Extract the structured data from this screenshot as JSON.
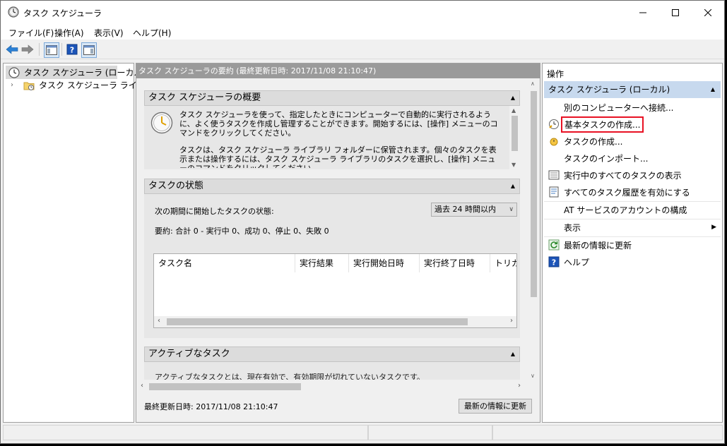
{
  "window": {
    "title": "タスク スケジューラ"
  },
  "menu": [
    "ファイル(F)",
    "操作(A)",
    "表示(V)",
    "ヘルプ(H)"
  ],
  "tree": {
    "root": "タスク スケジューラ (ローカル)",
    "child": "タスク スケジューラ ライブラリ"
  },
  "center": {
    "header": "タスク スケジューラの要約 (最終更新日時: 2017/11/08 21:10:47)",
    "overview": {
      "title": "タスク スケジューラの概要",
      "para1": "タスク スケジューラを使って、指定したときにコンピューターで自動的に実行されるように、よく使うタスクを作成し管理することができます。開始するには、[操作] メニューのコマンドをクリックしてください。",
      "para2": "タスクは、タスク スケジューラ ライブラリ フォルダーに保管されます。個々のタスクを表示または操作するには、タスク スケジューラ ライブラリのタスクを選択し、[操作] メニューのコマンドをクリックしてください。"
    },
    "status": {
      "title": "タスクの状態",
      "period_label": "次の期間に開始したタスクの状態:",
      "period_value": "過去 24 時間以内",
      "summary": "要約: 合計 0 - 実行中 0、成功 0、停止 0、失敗 0",
      "columns": [
        "タスク名",
        "実行結果",
        "実行開始日時",
        "実行終了日時",
        "トリガー"
      ]
    },
    "active": {
      "title": "アクティブなタスク",
      "text": "アクティブなタスクとは、現在有効で、有効期限が切れていないタスクです。"
    },
    "footer": {
      "last_updated": "最終更新日時: 2017/11/08 21:10:47",
      "refresh_button": "最新の情報に更新"
    }
  },
  "actions": {
    "title": "操作",
    "group": "タスク スケジューラ (ローカル)",
    "items": [
      "別のコンピューターへ接続...",
      "基本タスクの作成...",
      "タスクの作成...",
      "タスクのインポート...",
      "実行中のすべてのタスクの表示",
      "すべてのタスク履歴を有効にする",
      "AT サービスのアカウントの構成",
      "表示",
      "最新の情報に更新",
      "ヘルプ"
    ]
  },
  "colors": {
    "highlight": "#e81123",
    "help_icon": "#1c54b8"
  }
}
